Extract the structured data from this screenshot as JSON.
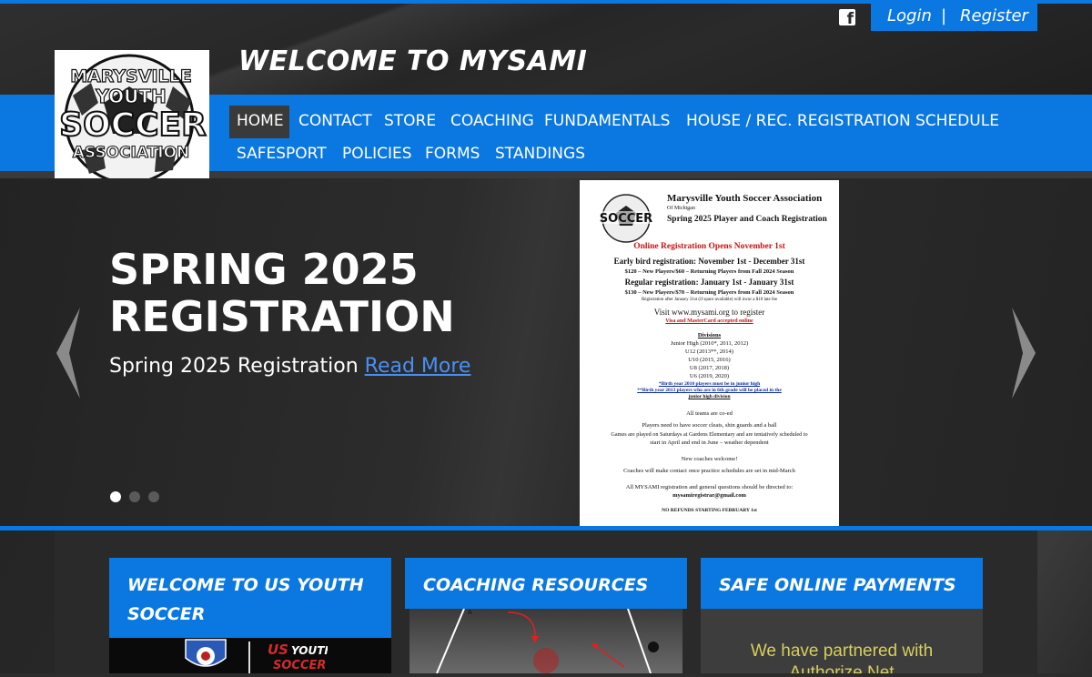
{
  "header": {
    "site_title": "WELCOME TO MYSAMI",
    "auth": {
      "login": "Login",
      "separator": "|",
      "register": "Register"
    }
  },
  "logo": {
    "lines": [
      "MARYSVILLE",
      "YOUTH",
      "SOCCER",
      "ASSOCIATION"
    ]
  },
  "nav": {
    "items": [
      "HOME",
      "CONTACT",
      "STORE",
      "COACHING",
      "FUNDAMENTALS",
      "HOUSE / REC. REGISTRATION",
      "SCHEDULE",
      "SAFESPORT",
      "POLICIES",
      "FORMS",
      "STANDINGS"
    ],
    "active": "HOME"
  },
  "hero": {
    "title_line1": "SPRING 2025",
    "title_line2": "REGISTRATION",
    "text": "Spring 2025 Registration",
    "link": "Read More",
    "prev_icon": "chevron-left-icon",
    "next_icon": "chevron-right-icon",
    "slides": 3,
    "active_slide": 1
  },
  "flyer": {
    "org": "Marysville Youth Soccer Association",
    "org_sub": "Of Michigan",
    "heading": "Spring 2025 Player and Coach Registration",
    "opens": "Online Registration Opens November 1st",
    "early": "Early bird registration: November 1st - December 31st",
    "early_fees": "$120 – New Players/$60 – Returning Players from Fall 2024 Season",
    "regular": "Regular registration: January 1st - January 31st",
    "regular_fees": "$130 – New Players/$70 – Returning Players from Fall 2024 Season",
    "late_note": "Registration after January 31st (if space available) will incur a $10 late fee",
    "visit": "Visit www.mysami.org to register",
    "cards": "Visa and MasterCard accepted online",
    "divisions_title": "Divisions",
    "divisions": [
      "Junior High (2010*, 2011, 2012)",
      "U12 (2013**, 2014)",
      "U10 (2015, 2016)",
      "U8 (2017, 2018)",
      "U6 (2019, 2020)"
    ],
    "note1": "*Birth year 2010 players must be in junior high",
    "note2": "**Birth year 2013 players who are in 6th grade will be placed in the",
    "note3": "junior high division",
    "coed": "All teams are co-ed",
    "gear": "Players need to have soccer cleats, shin guards and a ball",
    "games1": "Games are played on Saturdays at Gardens Elementary and are tentatively scheduled to",
    "games2": "start in April and end in June – weather dependent",
    "coaches": "New coaches welcome!",
    "contact_note": "Coaches will make contact once practice schedules are set in mid-March",
    "questions": "All MYSAMI registration and general questions should be directed to:",
    "email": "mysamiregistrar@gmail.com",
    "refunds": "NO REFUNDS STARTING FEBRUARY 1st"
  },
  "cards": [
    {
      "title_line1": "WELCOME TO US YOUTH",
      "title_line2": "SOCCER"
    },
    {
      "title_line1": "COACHING RESOURCES"
    },
    {
      "title_line1": "SAFE ONLINE PAYMENTS",
      "body_line1": "We have partnered with",
      "body_line2": "Authorize.Net"
    }
  ],
  "colors": {
    "accent": "#0a78e0",
    "nav_active": "#3a3a3a",
    "link": "#4a90f0",
    "flyer_red": "#cc1111",
    "payment_text": "#d8cf5a"
  }
}
